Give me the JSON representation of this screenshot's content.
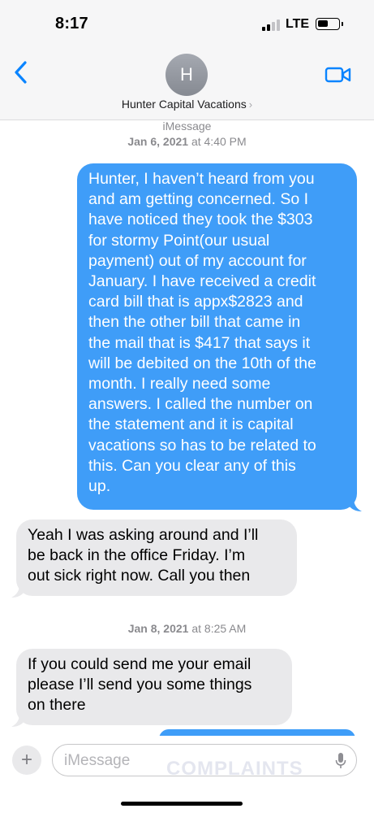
{
  "status_bar": {
    "time": "8:17",
    "carrier": "LTE"
  },
  "header": {
    "avatar_initial": "H",
    "contact_name": "Hunter Capital Vacations",
    "contact_chevron": "›"
  },
  "colors": {
    "accent": "#0a84ff",
    "outgoing_bubble": "#3f9df8",
    "incoming_bubble": "#e9e9eb"
  },
  "conversation": {
    "service_label": "iMessage",
    "timestamp_1": {
      "date": "Jan 6, 2021",
      "time": "at 4:40 PM"
    },
    "timestamp_2": {
      "date": "Jan 8, 2021",
      "time": "at 8:25 AM"
    },
    "messages": [
      {
        "direction": "outgoing",
        "lines": [
          "Hunter, I haven’t heard from you",
          "and am getting concerned. So I",
          "have noticed they took the $303",
          "for stormy Point(our usual",
          "payment) out of my account for",
          "January. I have received a credit",
          "card bill that is appx$2823 and",
          "then the other bill that came in",
          "the mail that is $417 that says it",
          "will be debited on the 10th of the",
          "month. I really need some",
          "answers. I called the number on",
          "the statement and it is capital",
          "vacations so has to be related to",
          "this. Can you clear any of this",
          "up."
        ]
      },
      {
        "direction": "incoming",
        "lines": [
          "Yeah I was asking around and I’ll",
          "be back in the office Friday. I’m",
          "out sick right now. Call you then"
        ]
      },
      {
        "direction": "incoming",
        "lines": [
          "If you could send me your email",
          "please I’ll send you some things",
          "on there"
        ]
      }
    ]
  },
  "composer": {
    "placeholder": "iMessage",
    "plus_label": "+"
  },
  "watermark": "COMPLAINTS",
  "icons": {
    "back": "chevron-left-icon",
    "video": "video-camera-icon",
    "mic": "microphone-icon",
    "add": "plus-icon"
  }
}
